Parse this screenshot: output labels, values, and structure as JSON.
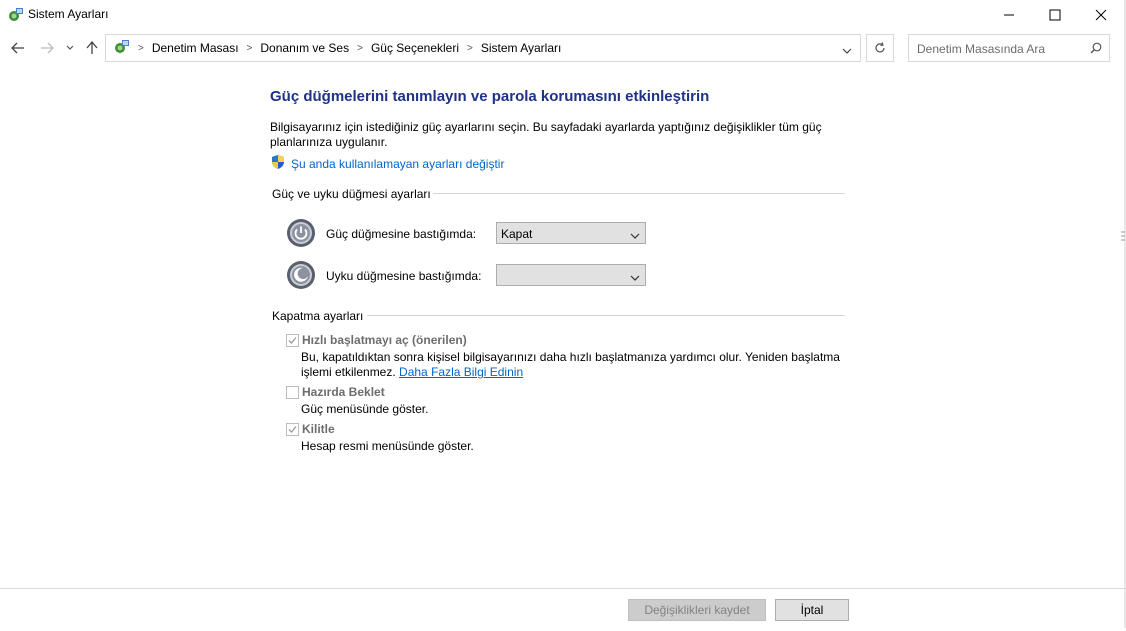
{
  "window": {
    "title": "Sistem Ayarları",
    "icons": {
      "app": "control-panel-icon",
      "minimize": "minimize-icon",
      "maximize": "maximize-icon",
      "close": "close-icon"
    }
  },
  "nav": {
    "breadcrumbs": [
      "Denetim Masası",
      "Donanım ve Ses",
      "Güç Seçenekleri",
      "Sistem Ayarları"
    ],
    "search_placeholder": "Denetim Masasında Ara"
  },
  "main": {
    "heading": "Güç düğmelerini tanımlayın ve parola korumasını etkinleştirin",
    "description": "Bilgisayarınız için istediğiniz güç ayarlarını seçin. Bu sayfadaki ayarlarda yaptığınız değişiklikler tüm güç planlarınıza uygulanır.",
    "change_settings_link": "Şu anda kullanılamayan ayarları değiştir",
    "power_group": {
      "label": "Güç ve uyku düğmesi ayarları",
      "power_button_label": "Güç düğmesine bastığımda:",
      "power_button_value": "Kapat",
      "sleep_button_label": "Uyku düğmesine bastığımda:",
      "sleep_button_value": ""
    },
    "shutdown_group": {
      "label": "Kapatma ayarları",
      "items": [
        {
          "label": "Hızlı başlatmayı aç (önerilen)",
          "checked": true,
          "desc": "Bu, kapatıldıktan sonra kişisel bilgisayarınızı daha hızlı başlatmanıza yardımcı olur. Yeniden başlatma",
          "desc2": "işlemi etkilenmez.",
          "link": "Daha Fazla Bilgi Edinin"
        },
        {
          "label": "Hazırda Beklet",
          "checked": false,
          "desc": "Güç menüsünde göster."
        },
        {
          "label": "Kilitle",
          "checked": true,
          "desc": "Hesap resmi menüsünde göster."
        }
      ]
    }
  },
  "footer": {
    "save_label": "Değişiklikleri kaydet",
    "cancel_label": "İptal"
  }
}
